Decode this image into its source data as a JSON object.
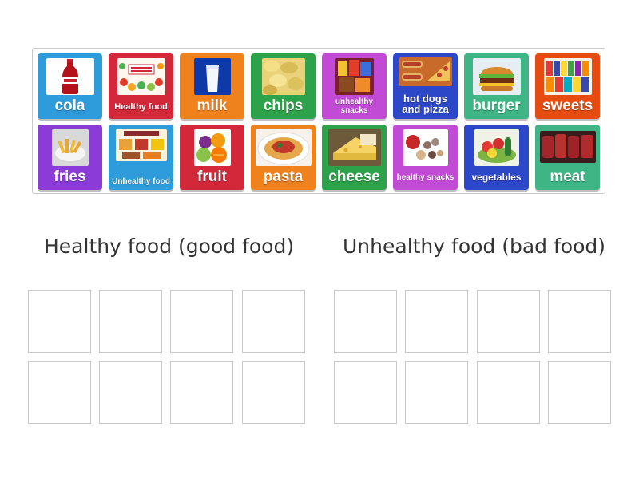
{
  "cards": [
    {
      "label": "cola",
      "color": "#2e9bdb",
      "icon": "cola-bottle-image"
    },
    {
      "label": "Healthy food",
      "color": "#d2283a",
      "icon": "healthy-food-poster-image"
    },
    {
      "label": "milk",
      "color": "#f0821e",
      "icon": "milk-glass-image"
    },
    {
      "label": "chips",
      "color": "#2ea24a",
      "icon": "potato-chips-image"
    },
    {
      "label": "unhealthy snacks",
      "color": "#c24bd6",
      "icon": "junk-snacks-image"
    },
    {
      "label": "hot dogs and pizza",
      "color": "#2d47c9",
      "icon": "hot-dogs-pizza-image"
    },
    {
      "label": "burger",
      "color": "#3fb585",
      "icon": "burger-image"
    },
    {
      "label": "sweets",
      "color": "#e64b12",
      "icon": "sweets-box-image"
    },
    {
      "label": "fries",
      "color": "#8a3bd8",
      "icon": "fries-bowl-image"
    },
    {
      "label": "Unhealthy food",
      "color": "#2e9bdb",
      "icon": "unhealthy-food-poster-image"
    },
    {
      "label": "fruit",
      "color": "#d2283a",
      "icon": "fruit-image"
    },
    {
      "label": "pasta",
      "color": "#f0821e",
      "icon": "pasta-plate-image"
    },
    {
      "label": "cheese",
      "color": "#2ea24a",
      "icon": "cheese-image"
    },
    {
      "label": "healthy snacks",
      "color": "#c24bd6",
      "icon": "healthy-snacks-image"
    },
    {
      "label": "vegetables",
      "color": "#2d47c9",
      "icon": "vegetables-image"
    },
    {
      "label": "meat",
      "color": "#3fb585",
      "icon": "raw-meat-image"
    }
  ],
  "groups": {
    "healthy": {
      "title": "Healthy food (good food)"
    },
    "unhealthy": {
      "title": "Unhealthy food (bad food)"
    }
  }
}
